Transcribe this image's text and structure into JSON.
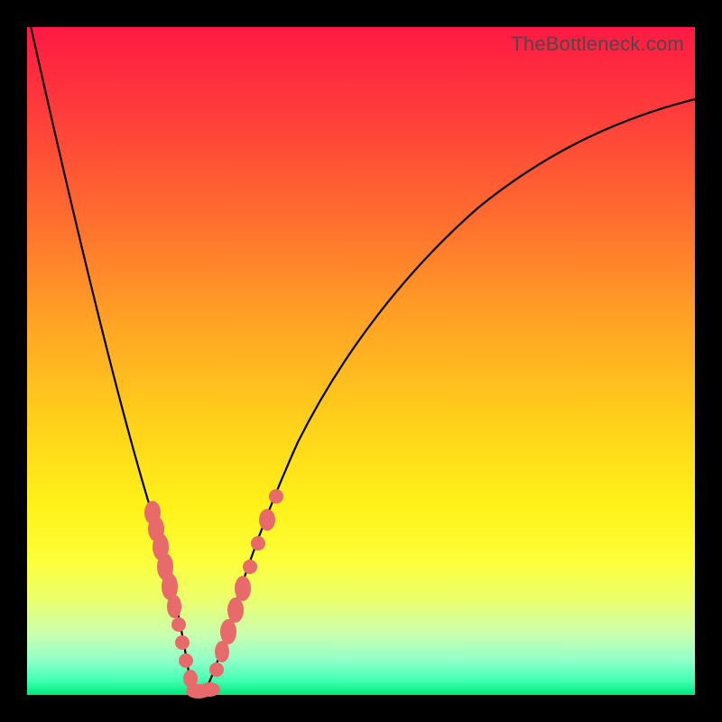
{
  "watermark": "TheBottleneck.com",
  "colors": {
    "frame": "#000000",
    "marker": "#e86a6a",
    "curve": "#000000",
    "gradient_top": "#ff1a43",
    "gradient_bottom": "#00e87a"
  },
  "chart_data": {
    "type": "line",
    "title": "",
    "xlabel": "",
    "ylabel": "",
    "xlim": [
      0,
      100
    ],
    "ylim": [
      0,
      100
    ],
    "x": [
      0,
      2,
      4,
      6,
      8,
      10,
      12,
      14,
      16,
      18,
      19,
      20,
      21,
      22,
      23,
      24,
      25,
      26,
      28,
      30,
      32,
      35,
      40,
      45,
      50,
      55,
      60,
      65,
      70,
      75,
      80,
      85,
      90,
      95,
      100
    ],
    "y": [
      100,
      92,
      84,
      76,
      68,
      60,
      52,
      44,
      35,
      25,
      20,
      15,
      9,
      4,
      1,
      0,
      1,
      4,
      12,
      21,
      29,
      38,
      50,
      58,
      64,
      69,
      72.5,
      75.5,
      78,
      80,
      81.8,
      83.3,
      84.5,
      85.5,
      86.3
    ],
    "minimum_x": 24,
    "markers": {
      "left_branch_x_range": [
        17.5,
        22.5
      ],
      "right_branch_x_range": [
        26,
        31
      ],
      "note": "Dense salmon-colored markers cluster along both branches near the minimum, roughly y in [5, 35]."
    }
  }
}
